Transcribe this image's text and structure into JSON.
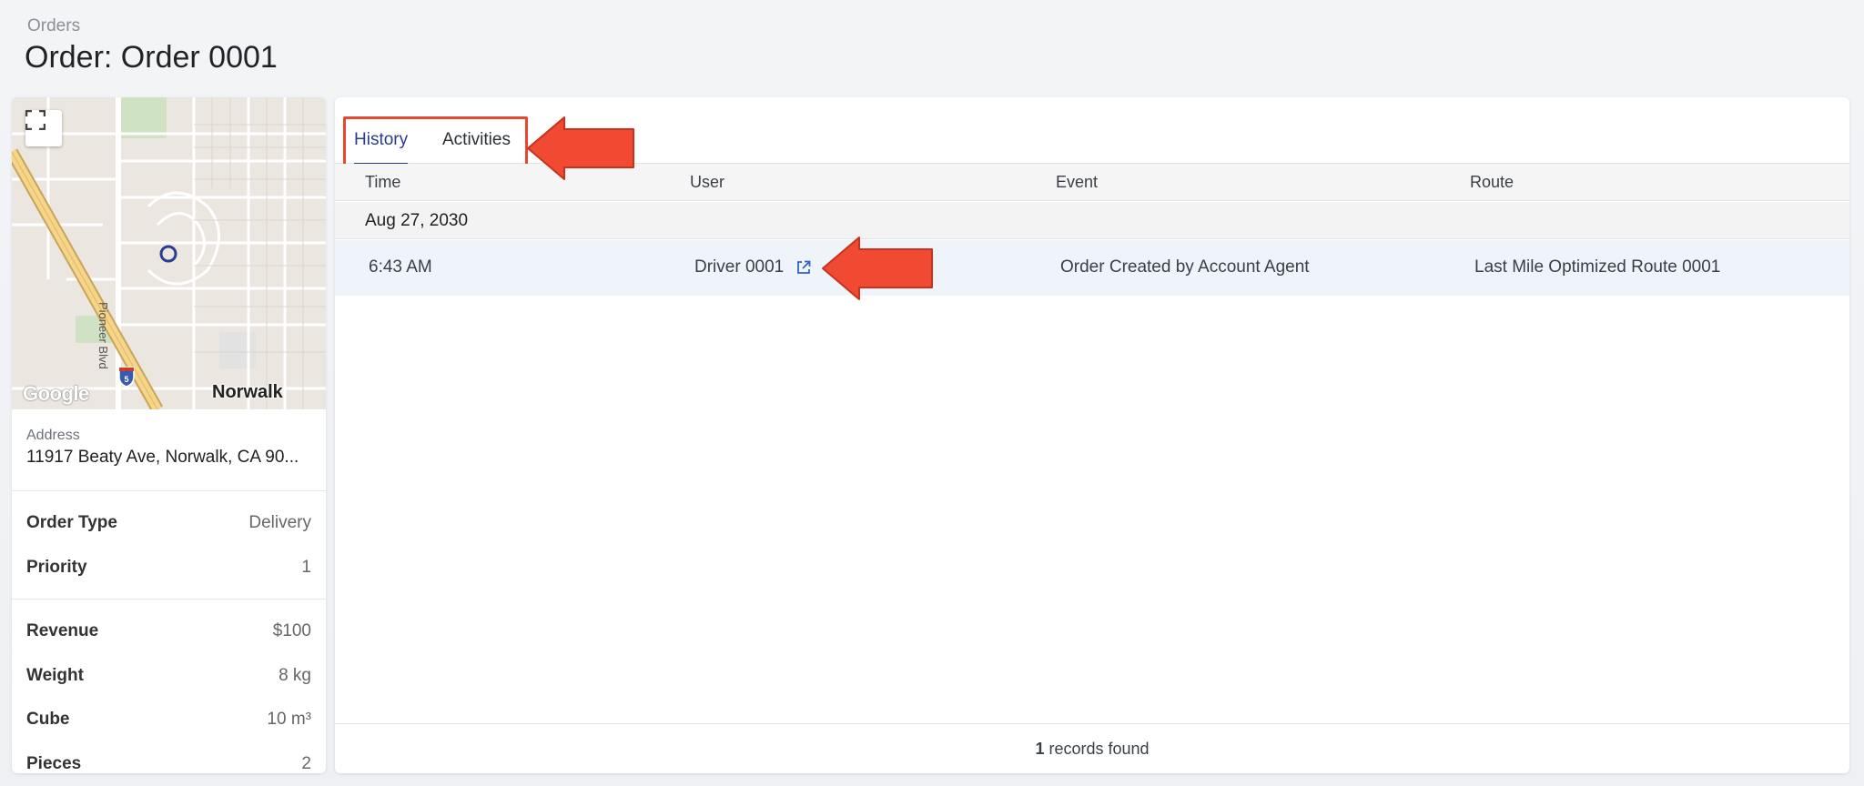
{
  "breadcrumb": "Orders",
  "page_title": "Order: Order 0001",
  "map": {
    "city_label": "Norwalk",
    "road_label": "Pioneer Blvd",
    "attribution": "Google",
    "interstate_shield": "5"
  },
  "address": {
    "label": "Address",
    "value": "11917 Beaty Ave, Norwalk, CA 90..."
  },
  "properties_group1": [
    {
      "label": "Order Type",
      "value": "Delivery"
    },
    {
      "label": "Priority",
      "value": "1"
    }
  ],
  "properties_group2": [
    {
      "label": "Revenue",
      "value": "$100"
    },
    {
      "label": "Weight",
      "value": "8 kg"
    },
    {
      "label": "Cube",
      "value": "10 m³"
    },
    {
      "label": "Pieces",
      "value": "2"
    }
  ],
  "tabs": [
    {
      "label": "History",
      "active": true
    },
    {
      "label": "Activities",
      "active": false
    }
  ],
  "table": {
    "columns": [
      "Time",
      "User",
      "Event",
      "Route"
    ],
    "group": "Aug 27, 2030",
    "rows": [
      {
        "time": "6:43 AM",
        "user": "Driver 0001",
        "event": "Order Created by Account Agent",
        "route": "Last Mile Optimized Route 0001"
      }
    ]
  },
  "footer": {
    "count": "1",
    "suffix": "records found"
  },
  "colors": {
    "accent": "#2a3d8f",
    "annotation": "#e8472f",
    "row_highlight": "#eff4fa"
  }
}
